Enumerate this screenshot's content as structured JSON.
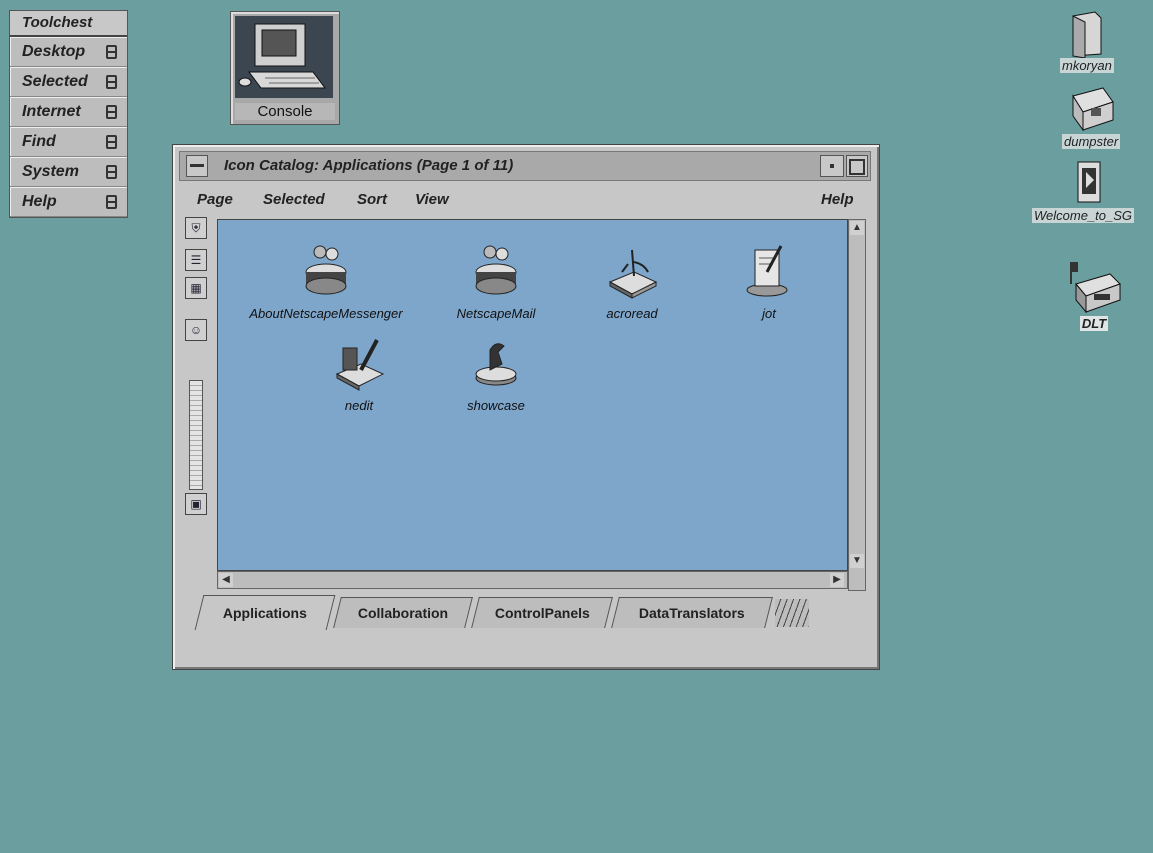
{
  "toolchest": {
    "title": "Toolchest",
    "items": [
      {
        "label": "Desktop"
      },
      {
        "label": "Selected"
      },
      {
        "label": "Internet"
      },
      {
        "label": "Find"
      },
      {
        "label": "System"
      },
      {
        "label": "Help"
      }
    ]
  },
  "console": {
    "label": "Console"
  },
  "desktop_icons": [
    {
      "label": "mkoryan",
      "icon": "folder-icon"
    },
    {
      "label": "dumpster",
      "icon": "dumpster-icon"
    },
    {
      "label": "Welcome_to_SG",
      "icon": "welcome-icon"
    },
    {
      "label": "DLT",
      "icon": "tape-drive-icon"
    }
  ],
  "window": {
    "title": "Icon Catalog: Applications (Page 1 of 11)",
    "menu": {
      "page": "Page",
      "selected": "Selected",
      "sort": "Sort",
      "view": "View",
      "help": "Help"
    },
    "apps": [
      {
        "label": "AboutNetscapeMessenger",
        "icon": "netscape-messenger-icon"
      },
      {
        "label": "NetscapeMail",
        "icon": "netscape-mail-icon"
      },
      {
        "label": "acroread",
        "icon": "acroread-icon"
      },
      {
        "label": "jot",
        "icon": "jot-icon"
      },
      {
        "label": "nedit",
        "icon": "nedit-icon"
      },
      {
        "label": "showcase",
        "icon": "showcase-icon"
      }
    ],
    "tabs": [
      {
        "label": "Applications",
        "active": true
      },
      {
        "label": "Collaboration"
      },
      {
        "label": "ControlPanels"
      },
      {
        "label": "DataTranslators"
      }
    ]
  },
  "colors": {
    "desktop": "#6b9e9e",
    "canvas": "#7ea6cb",
    "window": "#c7c7c7"
  }
}
